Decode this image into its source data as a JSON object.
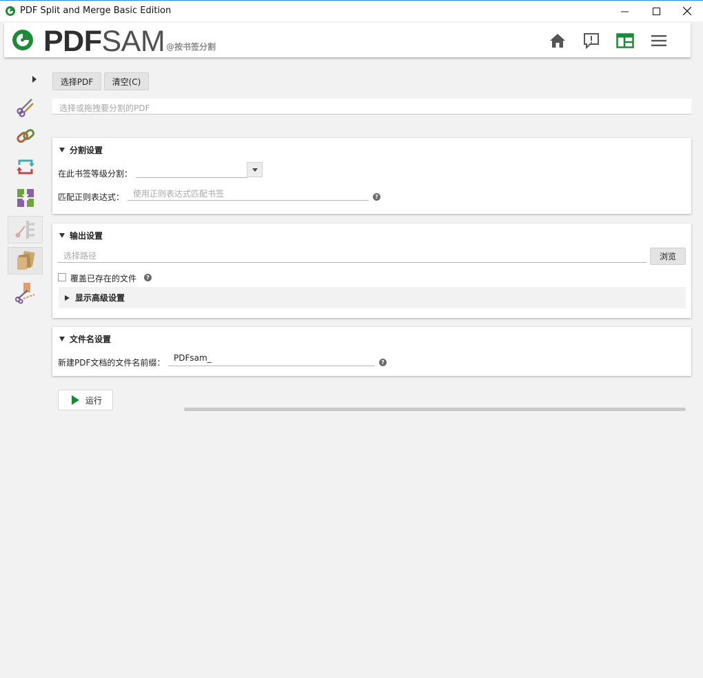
{
  "window": {
    "title": "PDF Split and Merge Basic Edition"
  },
  "header": {
    "brand_pdf": "PDF",
    "brand_sam": "SAM",
    "subtitle": "@按书签分割"
  },
  "toolbar": {
    "select_pdf": "选择PDF",
    "clear": "清空(C)",
    "drop_placeholder": "选择或拖拽要分割的PDF"
  },
  "split_settings": {
    "title": "分割设置",
    "level_label": "在此书签等级分割：",
    "level_value": "",
    "regex_label": "匹配正则表达式：",
    "regex_placeholder": "使用正则表达式匹配书签"
  },
  "output_settings": {
    "title": "输出设置",
    "path_placeholder": "选择路径",
    "browse": "浏览",
    "overwrite_label": "覆盖已存在的文件",
    "overwrite_checked": false,
    "advanced": "显示高级设置"
  },
  "filename_settings": {
    "title": "文件名设置",
    "prefix_label": "新建PDF文档的文件名前缀：",
    "prefix_value": "PDFsam_"
  },
  "run": {
    "label": "运行",
    "progress": 0
  },
  "colors": {
    "accent_green": "#1a8a3a",
    "titlebar_border": "#2a8fd3"
  }
}
